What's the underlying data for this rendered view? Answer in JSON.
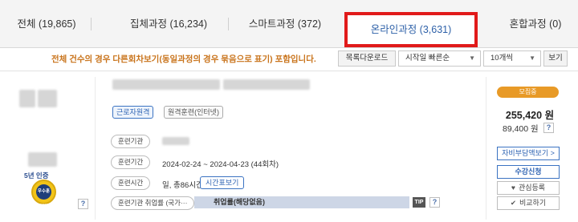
{
  "tabs": [
    {
      "label": "전체 (19,865)"
    },
    {
      "label": "집체과정 (16,234)"
    },
    {
      "label": "스마트과정 (372)"
    },
    {
      "label": "온라인과정 (3,631)"
    },
    {
      "label": "혼합과정 (0)"
    }
  ],
  "toolbar": {
    "notice": "전체 건수의 경우 다른회차보기(동일과정의 경우 묶음으로 표기) 포함입니다.",
    "download_label": "목록다운로드",
    "sort_value": "시작일 빠른순",
    "count_value": "10개씩",
    "view_label": "보기"
  },
  "course": {
    "cert_label": "5년 인증",
    "medal_text": "우수훈련기관",
    "tags": [
      "근로자원격",
      "원격훈련(인터넷)"
    ],
    "rows": {
      "org_label": "훈련기관",
      "period_label": "훈련기간",
      "period_value": "2024-02-24 ~ 2024-04-23 (44회차)",
      "time_label": "훈련시간",
      "time_value": "일, 총86시간",
      "schedule_button": "시간표보기",
      "employment_label": "훈련기관 취업률 (국가···",
      "employment_value": "취업률(해당없음)",
      "tip_label": "TIP"
    },
    "status_badge": "모집중",
    "price_main": "255,420 원",
    "price_sub": "89,400 원",
    "buttons": {
      "copay": "자비부담액보기 >",
      "apply": "수강신청",
      "interest": "관심등록",
      "compare": "비교하기"
    },
    "help_mark": "?"
  },
  "colors": {
    "active_tab_border": "#e11a1a",
    "notice": "#c9741c",
    "accent_blue": "#2f64b3",
    "badge_orange": "#e89a27"
  }
}
